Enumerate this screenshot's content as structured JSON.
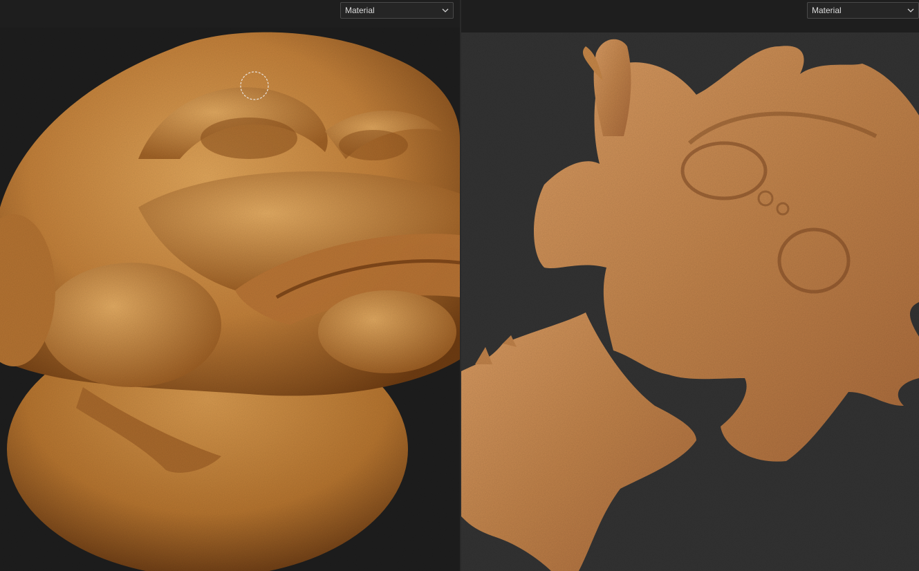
{
  "viewport_3d": {
    "mode_dropdown": {
      "selected": "Material",
      "icon": "chevron-down-icon"
    },
    "brush_cursor_icon": "brush-cursor-icon"
  },
  "viewport_uv": {
    "mode_dropdown": {
      "selected": "Material",
      "icon": "chevron-down-icon"
    }
  },
  "colors": {
    "background": "#1e1e1e",
    "uv_background": "#333333",
    "clay_light": "#d99a4c",
    "clay_dark": "#7a4414",
    "uv_copper": "#c98a52"
  }
}
